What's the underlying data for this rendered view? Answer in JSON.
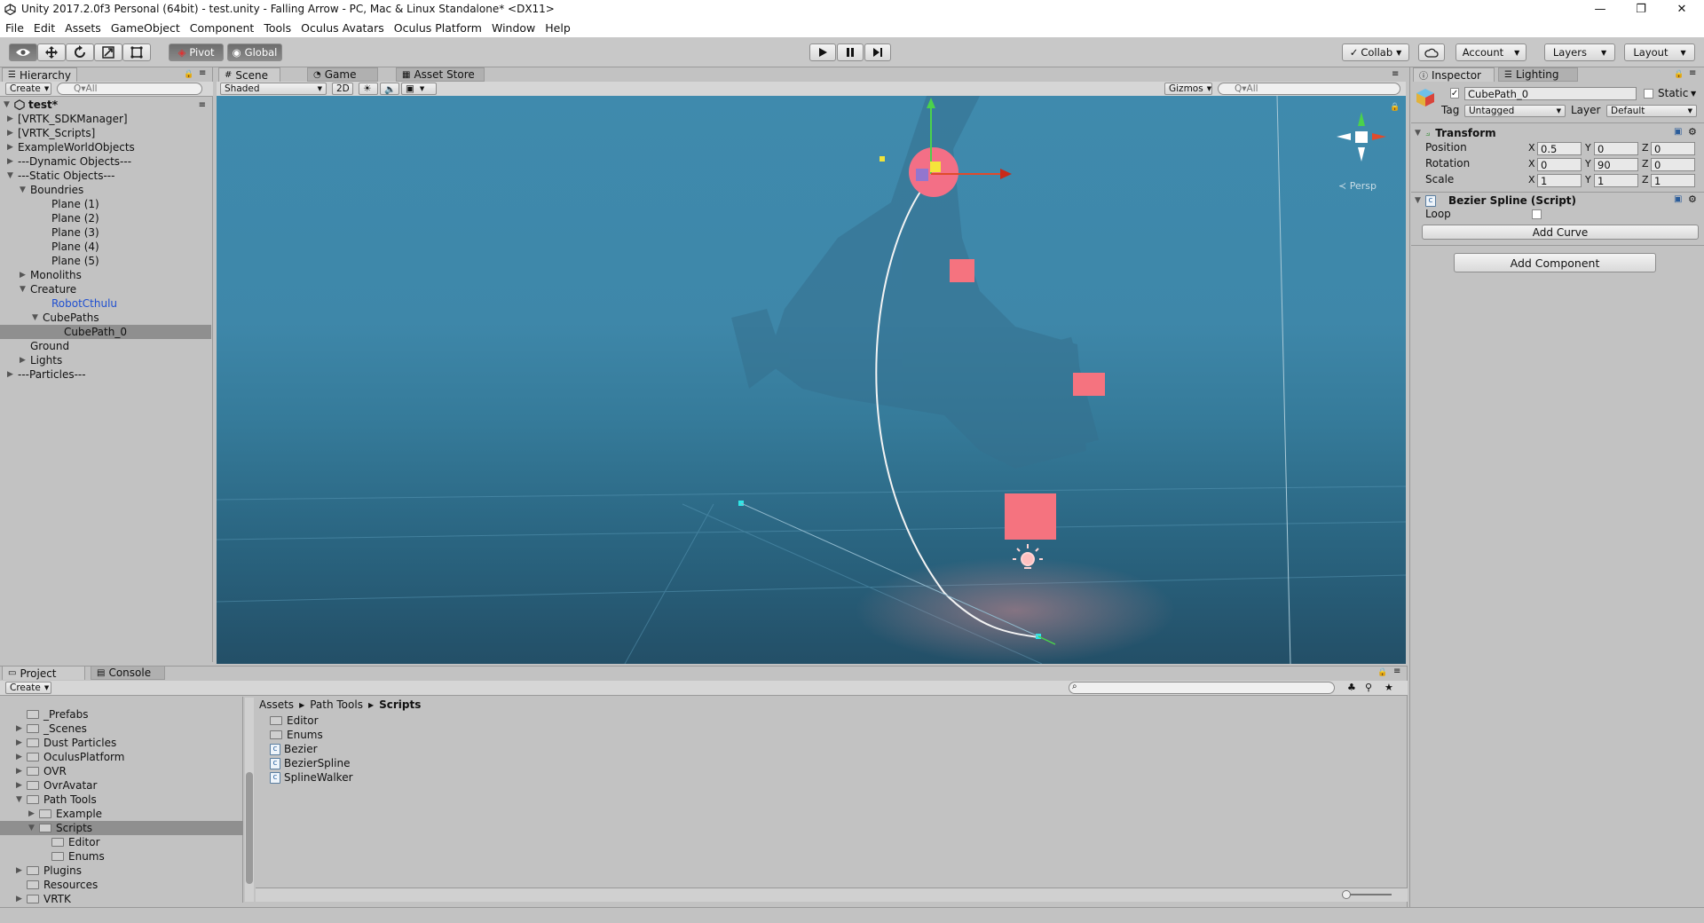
{
  "window": {
    "title": "Unity 2017.2.0f3 Personal (64bit) - test.unity - Falling Arrow - PC, Mac & Linux Standalone* <DX11>",
    "controls": {
      "minimize": "—",
      "restore": "❐",
      "close": "✕"
    }
  },
  "menu": [
    "File",
    "Edit",
    "Assets",
    "GameObject",
    "Component",
    "Tools",
    "Oculus Avatars",
    "Oculus Platform",
    "Window",
    "Help"
  ],
  "toolbar": {
    "pivot": "Pivot",
    "global": "Global",
    "collab": "Collab",
    "account": "Account",
    "layers": "Layers",
    "layout": "Layout"
  },
  "hierarchy": {
    "tab": "Hierarchy",
    "create": "Create",
    "search_placeholder": "Q▾All",
    "scene_name": "test*",
    "items": [
      {
        "label": "[VRTK_SDKManager]",
        "depth": 1,
        "arrow": "▶"
      },
      {
        "label": "[VRTK_Scripts]",
        "depth": 1,
        "arrow": "▶"
      },
      {
        "label": "ExampleWorldObjects",
        "depth": 1,
        "arrow": "▶"
      },
      {
        "label": "---Dynamic Objects---",
        "depth": 1,
        "arrow": "▶"
      },
      {
        "label": "---Static Objects---",
        "depth": 1,
        "arrow": "▼"
      },
      {
        "label": "Boundries",
        "depth": 2,
        "arrow": "▼"
      },
      {
        "label": "Plane (1)",
        "depth": 3,
        "arrow": ""
      },
      {
        "label": "Plane (2)",
        "depth": 3,
        "arrow": ""
      },
      {
        "label": "Plane (3)",
        "depth": 3,
        "arrow": ""
      },
      {
        "label": "Plane (4)",
        "depth": 3,
        "arrow": ""
      },
      {
        "label": "Plane (5)",
        "depth": 3,
        "arrow": ""
      },
      {
        "label": "Monoliths",
        "depth": 2,
        "arrow": "▶"
      },
      {
        "label": "Creature",
        "depth": 2,
        "arrow": "▼"
      },
      {
        "label": "RobotCthulu",
        "depth": 3,
        "arrow": "",
        "prefab": true
      },
      {
        "label": "CubePaths",
        "depth": 3,
        "arrow": "▼"
      },
      {
        "label": "CubePath_0",
        "depth": 4,
        "arrow": "",
        "selected": true
      },
      {
        "label": "Ground",
        "depth": 2,
        "arrow": ""
      },
      {
        "label": "Lights",
        "depth": 2,
        "arrow": "▶"
      },
      {
        "label": "---Particles---",
        "depth": 1,
        "arrow": "▶"
      }
    ]
  },
  "scene": {
    "tabs": [
      "Scene",
      "Game",
      "Asset Store"
    ],
    "shading": "Shaded",
    "mode_2d": "2D",
    "gizmos": "Gizmos",
    "search_placeholder": "Q▾All",
    "persp": "≺ Persp"
  },
  "inspector": {
    "tabs": [
      "Inspector",
      "Lighting"
    ],
    "object_name": "CubePath_0",
    "static_label": "Static",
    "tag_label": "Tag",
    "tag_value": "Untagged",
    "layer_label": "Layer",
    "layer_value": "Default",
    "transform": {
      "title": "Transform",
      "rows": [
        {
          "label": "Position",
          "x": "0.5",
          "y": "0",
          "z": "0"
        },
        {
          "label": "Rotation",
          "x": "0",
          "y": "90",
          "z": "0"
        },
        {
          "label": "Scale",
          "x": "1",
          "y": "1",
          "z": "1"
        }
      ]
    },
    "script": {
      "title": "Bezier Spline (Script)",
      "loop_label": "Loop",
      "add_curve": "Add Curve"
    },
    "add_component": "Add Component"
  },
  "project": {
    "tabs": [
      "Project",
      "Console"
    ],
    "create": "Create",
    "breadcrumb": [
      "Assets",
      "Path Tools",
      "Scripts"
    ],
    "tree": [
      {
        "label": "_Prefabs",
        "depth": 1,
        "arrow": ""
      },
      {
        "label": "_Scenes",
        "depth": 1,
        "arrow": "▶"
      },
      {
        "label": "Dust Particles",
        "depth": 1,
        "arrow": "▶"
      },
      {
        "label": "OculusPlatform",
        "depth": 1,
        "arrow": "▶"
      },
      {
        "label": "OVR",
        "depth": 1,
        "arrow": "▶"
      },
      {
        "label": "OvrAvatar",
        "depth": 1,
        "arrow": "▶"
      },
      {
        "label": "Path Tools",
        "depth": 1,
        "arrow": "▼"
      },
      {
        "label": "Example",
        "depth": 2,
        "arrow": "▶"
      },
      {
        "label": "Scripts",
        "depth": 2,
        "arrow": "▼",
        "selected": true
      },
      {
        "label": "Editor",
        "depth": 3,
        "arrow": ""
      },
      {
        "label": "Enums",
        "depth": 3,
        "arrow": ""
      },
      {
        "label": "Plugins",
        "depth": 1,
        "arrow": "▶"
      },
      {
        "label": "Resources",
        "depth": 1,
        "arrow": ""
      },
      {
        "label": "VRTK",
        "depth": 1,
        "arrow": "▶"
      }
    ],
    "files": [
      {
        "label": "Editor",
        "kind": "folder"
      },
      {
        "label": "Enums",
        "kind": "folder"
      },
      {
        "label": "Bezier",
        "kind": "script"
      },
      {
        "label": "BezierSpline",
        "kind": "script"
      },
      {
        "label": "SplineWalker",
        "kind": "script"
      }
    ]
  },
  "icons": {
    "view_tool": "eye-icon",
    "move_tool": "move-icon",
    "rotate_tool": "rotate-icon",
    "scale_tool": "scale-icon",
    "rect_tool": "rect-icon"
  }
}
